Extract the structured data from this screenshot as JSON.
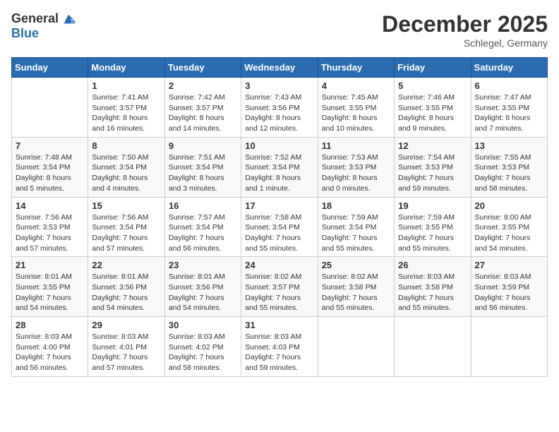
{
  "logo": {
    "general": "General",
    "blue": "Blue"
  },
  "title": "December 2025",
  "subtitle": "Schlegel, Germany",
  "weekdays": [
    "Sunday",
    "Monday",
    "Tuesday",
    "Wednesday",
    "Thursday",
    "Friday",
    "Saturday"
  ],
  "weeks": [
    [
      {
        "day": "",
        "info": ""
      },
      {
        "day": "1",
        "info": "Sunrise: 7:41 AM\nSunset: 3:57 PM\nDaylight: 8 hours\nand 16 minutes."
      },
      {
        "day": "2",
        "info": "Sunrise: 7:42 AM\nSunset: 3:57 PM\nDaylight: 8 hours\nand 14 minutes."
      },
      {
        "day": "3",
        "info": "Sunrise: 7:43 AM\nSunset: 3:56 PM\nDaylight: 8 hours\nand 12 minutes."
      },
      {
        "day": "4",
        "info": "Sunrise: 7:45 AM\nSunset: 3:55 PM\nDaylight: 8 hours\nand 10 minutes."
      },
      {
        "day": "5",
        "info": "Sunrise: 7:46 AM\nSunset: 3:55 PM\nDaylight: 8 hours\nand 9 minutes."
      },
      {
        "day": "6",
        "info": "Sunrise: 7:47 AM\nSunset: 3:55 PM\nDaylight: 8 hours\nand 7 minutes."
      }
    ],
    [
      {
        "day": "7",
        "info": "Sunrise: 7:48 AM\nSunset: 3:54 PM\nDaylight: 8 hours\nand 5 minutes."
      },
      {
        "day": "8",
        "info": "Sunrise: 7:50 AM\nSunset: 3:54 PM\nDaylight: 8 hours\nand 4 minutes."
      },
      {
        "day": "9",
        "info": "Sunrise: 7:51 AM\nSunset: 3:54 PM\nDaylight: 8 hours\nand 3 minutes."
      },
      {
        "day": "10",
        "info": "Sunrise: 7:52 AM\nSunset: 3:54 PM\nDaylight: 8 hours\nand 1 minute."
      },
      {
        "day": "11",
        "info": "Sunrise: 7:53 AM\nSunset: 3:53 PM\nDaylight: 8 hours\nand 0 minutes."
      },
      {
        "day": "12",
        "info": "Sunrise: 7:54 AM\nSunset: 3:53 PM\nDaylight: 7 hours\nand 59 minutes."
      },
      {
        "day": "13",
        "info": "Sunrise: 7:55 AM\nSunset: 3:53 PM\nDaylight: 7 hours\nand 58 minutes."
      }
    ],
    [
      {
        "day": "14",
        "info": "Sunrise: 7:56 AM\nSunset: 3:53 PM\nDaylight: 7 hours\nand 57 minutes."
      },
      {
        "day": "15",
        "info": "Sunrise: 7:56 AM\nSunset: 3:54 PM\nDaylight: 7 hours\nand 57 minutes."
      },
      {
        "day": "16",
        "info": "Sunrise: 7:57 AM\nSunset: 3:54 PM\nDaylight: 7 hours\nand 56 minutes."
      },
      {
        "day": "17",
        "info": "Sunrise: 7:58 AM\nSunset: 3:54 PM\nDaylight: 7 hours\nand 55 minutes."
      },
      {
        "day": "18",
        "info": "Sunrise: 7:59 AM\nSunset: 3:54 PM\nDaylight: 7 hours\nand 55 minutes."
      },
      {
        "day": "19",
        "info": "Sunrise: 7:59 AM\nSunset: 3:55 PM\nDaylight: 7 hours\nand 55 minutes."
      },
      {
        "day": "20",
        "info": "Sunrise: 8:00 AM\nSunset: 3:55 PM\nDaylight: 7 hours\nand 54 minutes."
      }
    ],
    [
      {
        "day": "21",
        "info": "Sunrise: 8:01 AM\nSunset: 3:55 PM\nDaylight: 7 hours\nand 54 minutes."
      },
      {
        "day": "22",
        "info": "Sunrise: 8:01 AM\nSunset: 3:56 PM\nDaylight: 7 hours\nand 54 minutes."
      },
      {
        "day": "23",
        "info": "Sunrise: 8:01 AM\nSunset: 3:56 PM\nDaylight: 7 hours\nand 54 minutes."
      },
      {
        "day": "24",
        "info": "Sunrise: 8:02 AM\nSunset: 3:57 PM\nDaylight: 7 hours\nand 55 minutes."
      },
      {
        "day": "25",
        "info": "Sunrise: 8:02 AM\nSunset: 3:58 PM\nDaylight: 7 hours\nand 55 minutes."
      },
      {
        "day": "26",
        "info": "Sunrise: 8:03 AM\nSunset: 3:58 PM\nDaylight: 7 hours\nand 55 minutes."
      },
      {
        "day": "27",
        "info": "Sunrise: 8:03 AM\nSunset: 3:59 PM\nDaylight: 7 hours\nand 56 minutes."
      }
    ],
    [
      {
        "day": "28",
        "info": "Sunrise: 8:03 AM\nSunset: 4:00 PM\nDaylight: 7 hours\nand 56 minutes."
      },
      {
        "day": "29",
        "info": "Sunrise: 8:03 AM\nSunset: 4:01 PM\nDaylight: 7 hours\nand 57 minutes."
      },
      {
        "day": "30",
        "info": "Sunrise: 8:03 AM\nSunset: 4:02 PM\nDaylight: 7 hours\nand 58 minutes."
      },
      {
        "day": "31",
        "info": "Sunrise: 8:03 AM\nSunset: 4:03 PM\nDaylight: 7 hours\nand 59 minutes."
      },
      {
        "day": "",
        "info": ""
      },
      {
        "day": "",
        "info": ""
      },
      {
        "day": "",
        "info": ""
      }
    ]
  ]
}
